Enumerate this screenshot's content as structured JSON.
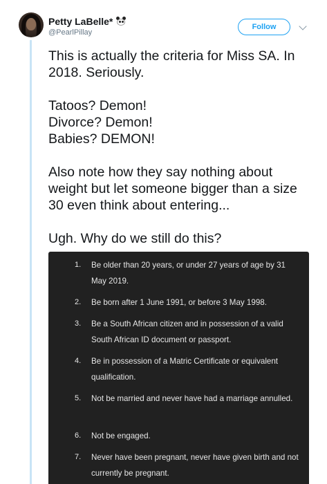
{
  "user": {
    "display_name": "Petty LaBelle*",
    "handle": "@PearlPillay",
    "badge_icon": "panda-icon"
  },
  "follow_button": {
    "label": "Follow"
  },
  "tweet": {
    "paragraphs": [
      "This is actually the criteria for Miss SA. In 2018. Seriously.",
      "Tatoos? Demon!\nDivorce? Demon!\nBabies? DEMON!",
      "Also note how they say nothing about weight but let someone bigger than a size 30 even think about entering...",
      "Ugh. Why do we still do this?"
    ]
  },
  "media": {
    "items": [
      {
        "num": "1.",
        "text": "Be older than 20 years, or under 27 years of age by 31 May 2019."
      },
      {
        "num": "2.",
        "text": "Be born after 1 June 1991, or before 3 May 1998."
      },
      {
        "num": "3.",
        "text": "Be a South African citizen and in possession of a valid South African ID document or passport."
      },
      {
        "num": "4.",
        "text": "Be in possession of a Matric Certificate or equivalent qualification."
      },
      {
        "num": "5.",
        "text": "Not be married and never have had a marriage annulled."
      },
      {
        "num": "6.",
        "text": "Not be engaged."
      },
      {
        "num": "7.",
        "text": "Never have been pregnant, never have given birth and not currently be pregnant."
      }
    ]
  },
  "colors": {
    "accent": "#1da1f2",
    "media_background": "#212121",
    "thread_line": "#c8e4f6"
  }
}
